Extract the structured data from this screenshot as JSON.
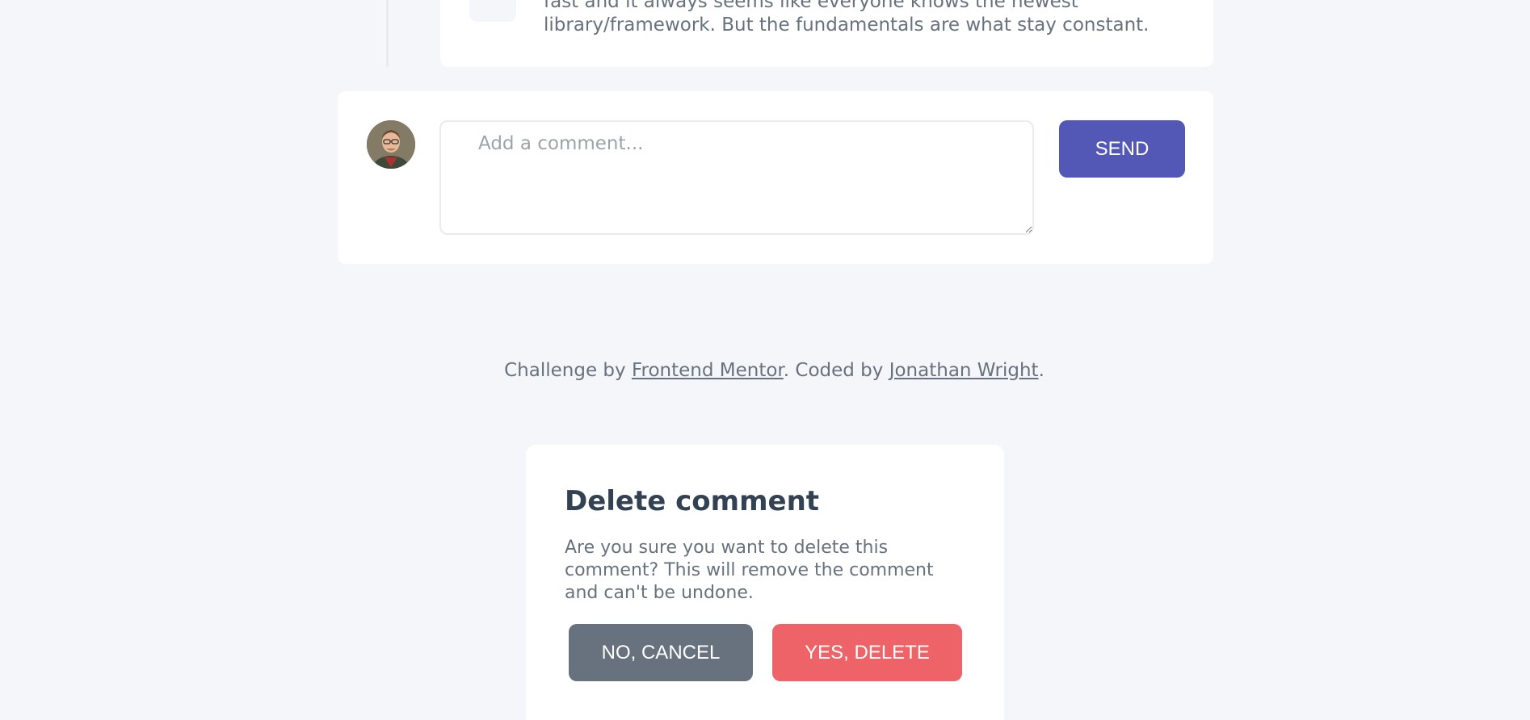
{
  "comment": {
    "text": "fast and it always seems like everyone knows the newest library/framework. But the fundamentals are what stay constant."
  },
  "add_comment": {
    "placeholder": "Add a comment...",
    "send_label": "SEND"
  },
  "attribution": {
    "prefix": "Challenge by ",
    "mentor_link": "Frontend Mentor",
    "middle": ". Coded by ",
    "author_link": "Jonathan Wright",
    "suffix": "."
  },
  "delete_modal": {
    "title": "Delete comment",
    "body": "Are you sure you want to delete this comment? This will remove the comment and can't be undone.",
    "cancel_label": "NO, CANCEL",
    "confirm_label": "YES, DELETE"
  },
  "colors": {
    "background": "#f5f6fa",
    "card": "#ffffff",
    "primary": "#5357b6",
    "danger": "#ed6368",
    "neutral": "#67727e",
    "heading": "#334253"
  }
}
